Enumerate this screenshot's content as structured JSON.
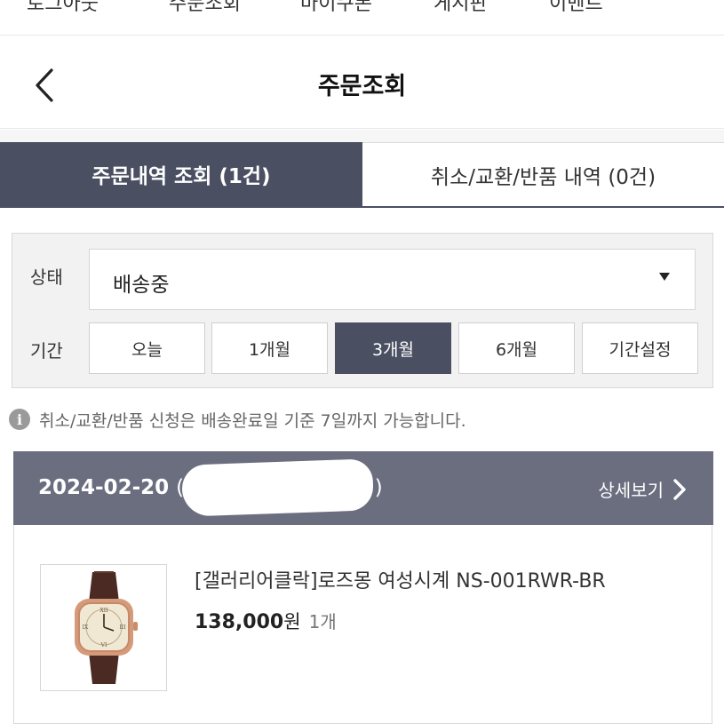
{
  "top_nav": {
    "items": [
      "로그아웃",
      "주문조회",
      "마이쿠폰",
      "게시판",
      "이벤트"
    ]
  },
  "header": {
    "title": "주문조회",
    "back_icon": "chevron-left-icon"
  },
  "tabs": [
    {
      "label": "주문내역 조회 (1건)",
      "active": true
    },
    {
      "label": "취소/교환/반품 내역 (0건)",
      "active": false
    }
  ],
  "filter": {
    "status_label": "상태",
    "status_value": "배송중",
    "period_label": "기간",
    "period_options": [
      "오늘",
      "1개월",
      "3개월",
      "6개월",
      "기간설정"
    ],
    "selected_period": "3개월"
  },
  "notice": {
    "icon": "info-icon",
    "text": "취소/교환/반품 신청은 배송완료일 기준 7일까지 가능합니다."
  },
  "order": {
    "date": "2024-02-20",
    "date_suffix": "(2",
    "date_close": ")",
    "detail_label": "상세보기",
    "product": {
      "name": "[갤러리어클락]로즈몽 여성시계 NS-001RWR-BR",
      "price": "138,000",
      "currency": "원",
      "quantity": "1개"
    }
  },
  "colors": {
    "primary": "#4a4f62",
    "order_header": "#6a6e7f",
    "filter_bg": "#f2f2f2"
  }
}
